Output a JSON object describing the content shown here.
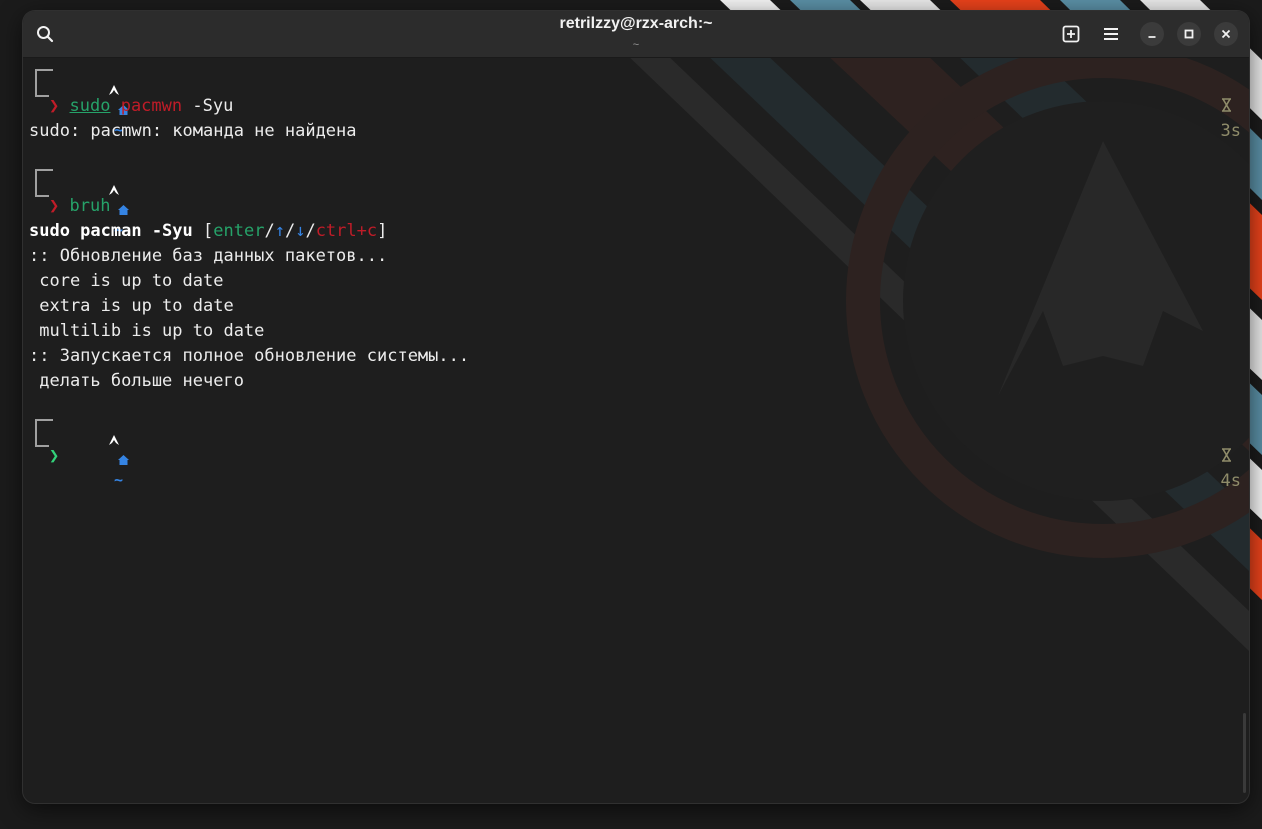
{
  "window": {
    "title": "retrilzzy@rzx-arch:~",
    "subtitle": "~"
  },
  "icons": {
    "search": "search-icon",
    "new_tab": "new-tab-icon",
    "menu": "hamburger-menu-icon",
    "minimize": "minimize-icon",
    "maximize": "maximize-icon",
    "close": "close-icon",
    "arch": "arch-logo-icon",
    "home": "home-icon",
    "hourglass": "hourglass-icon"
  },
  "colors": {
    "accent_red": "#e8421b",
    "accent_blue": "#5a8fa5",
    "prompt_error": "#c01c28",
    "prompt_ok": "#33d17a",
    "home_icon": "#3584e4",
    "duration": "#8f8c6a"
  },
  "terminal": {
    "blocks": [
      {
        "prompt_path": "~",
        "prompt_symbol": "❯",
        "command": {
          "cmd": "sudo",
          "arg1": "pacmwn",
          "rest": " -Syu"
        },
        "duration": "3s",
        "output": [
          "sudo: pacmwn: команда не найдена"
        ]
      },
      {
        "prompt_path": "~",
        "prompt_symbol": "❯",
        "command": {
          "cmd": "bruh"
        },
        "suggestion": {
          "text": "sudo pacman -Syu",
          "open": " [",
          "enter": "enter",
          "sep1": "/",
          "up": "↑",
          "sep2": "/",
          "down": "↓",
          "sep3": "/",
          "cancel": "ctrl+c",
          "close": "]"
        },
        "output": [
          ":: Обновление баз данных пакетов...",
          " core is up to date",
          " extra is up to date",
          " multilib is up to date",
          ":: Запускается полное обновление системы...",
          " делать больше нечего"
        ]
      },
      {
        "prompt_path": "~",
        "prompt_symbol": "❯",
        "duration": "4s"
      }
    ]
  }
}
